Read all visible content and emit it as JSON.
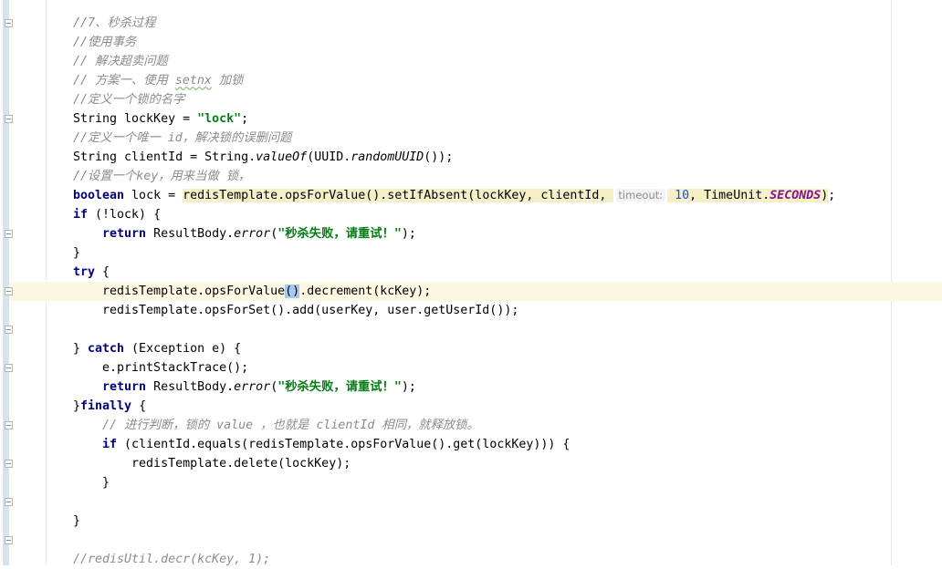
{
  "editor": {
    "lines": [
      {
        "id": "l1",
        "parts": [
          {
            "t": "//7、秒杀过程",
            "c": "cm"
          }
        ]
      },
      {
        "id": "l2",
        "parts": [
          {
            "t": "//使用事务",
            "c": "cm"
          }
        ]
      },
      {
        "id": "l3",
        "parts": [
          {
            "t": "// 解决超卖问题",
            "c": "cm"
          }
        ]
      },
      {
        "id": "l4",
        "parts": [
          {
            "t": "// 方案一、使用 ",
            "c": "cm"
          },
          {
            "t": "setnx",
            "c": "cm warn"
          },
          {
            "t": " 加锁",
            "c": "cm"
          }
        ]
      },
      {
        "id": "l5",
        "parts": [
          {
            "t": "//定义一个锁的名字",
            "c": "cm"
          }
        ]
      },
      {
        "id": "l6",
        "parts": [
          {
            "t": "String lockKey = "
          },
          {
            "t": "\"lock\"",
            "c": "str"
          },
          {
            "t": ";"
          }
        ]
      },
      {
        "id": "l7",
        "parts": [
          {
            "t": "//定义一个唯一 id，解决锁的误删问题",
            "c": "cm"
          }
        ]
      },
      {
        "id": "l8",
        "parts": [
          {
            "t": "String clientId = String."
          },
          {
            "t": "valueOf",
            "c": "it"
          },
          {
            "t": "(UUID."
          },
          {
            "t": "randomUUID",
            "c": "it"
          },
          {
            "t": "());"
          }
        ]
      },
      {
        "id": "l9",
        "parts": [
          {
            "t": "//设置一个key，用来当做 锁，",
            "c": "cm"
          }
        ]
      },
      {
        "id": "l10",
        "parts": [
          {
            "t": "boolean",
            "c": "kw"
          },
          {
            "t": " lock = "
          },
          {
            "t": "redisTemplate.opsForValue().setIfAbsent(lockKey, clientId, ",
            "c": "hl"
          },
          {
            "t": "timeout:",
            "c": "hint"
          },
          {
            "t": " ",
            "c": "hl"
          },
          {
            "t": "10",
            "c": "num hl"
          },
          {
            "t": ", TimeUnit.",
            "c": "hl"
          },
          {
            "t": "SECONDS",
            "c": "const hl"
          },
          {
            "t": ")",
            "c": "hl"
          },
          {
            "t": ";"
          }
        ]
      },
      {
        "id": "l11",
        "parts": [
          {
            "t": "if",
            "c": "kw"
          },
          {
            "t": " (!lock) {"
          }
        ]
      },
      {
        "id": "l12",
        "parts": [
          {
            "t": "    "
          },
          {
            "t": "return",
            "c": "kw"
          },
          {
            "t": " ResultBody."
          },
          {
            "t": "error",
            "c": "it"
          },
          {
            "t": "("
          },
          {
            "t": "\"秒杀失败，请重试！\"",
            "c": "str"
          },
          {
            "t": ");"
          }
        ]
      },
      {
        "id": "l13",
        "parts": [
          {
            "t": "}"
          }
        ]
      },
      {
        "id": "l14",
        "parts": [
          {
            "t": "try",
            "c": "kw"
          },
          {
            "t": " {"
          }
        ]
      },
      {
        "id": "l15",
        "current": true,
        "parts": [
          {
            "t": "    redisTemplate.opsForValue"
          },
          {
            "t": "()",
            "c": "brace-hl"
          },
          {
            "t": ".decrement(kcKey);"
          }
        ]
      },
      {
        "id": "l16",
        "parts": [
          {
            "t": "    redisTemplate.opsForSet().add(userKey, user.getUserId());"
          }
        ]
      },
      {
        "id": "l17",
        "parts": [
          {
            "t": ""
          }
        ]
      },
      {
        "id": "l18",
        "parts": [
          {
            "t": "} "
          },
          {
            "t": "catch",
            "c": "kw"
          },
          {
            "t": " (Exception e) {"
          }
        ]
      },
      {
        "id": "l19",
        "parts": [
          {
            "t": "    e.printStackTrace();"
          }
        ]
      },
      {
        "id": "l20",
        "parts": [
          {
            "t": "    "
          },
          {
            "t": "return",
            "c": "kw"
          },
          {
            "t": " ResultBody."
          },
          {
            "t": "error",
            "c": "it"
          },
          {
            "t": "("
          },
          {
            "t": "\"秒杀失败，请重试！\"",
            "c": "str"
          },
          {
            "t": ");"
          }
        ]
      },
      {
        "id": "l21",
        "parts": [
          {
            "t": "}"
          },
          {
            "t": "finally",
            "c": "kw"
          },
          {
            "t": " {"
          }
        ]
      },
      {
        "id": "l22",
        "parts": [
          {
            "t": "    "
          },
          {
            "t": "// 进行判断，锁的 value ，也就是 clientId 相同，就释放锁。",
            "c": "cm"
          }
        ]
      },
      {
        "id": "l23",
        "parts": [
          {
            "t": "    "
          },
          {
            "t": "if",
            "c": "kw"
          },
          {
            "t": " (clientId.equals(redisTemplate.opsForValue().get(lockKey))) {"
          }
        ]
      },
      {
        "id": "l24",
        "parts": [
          {
            "t": "        redisTemplate.delete(lockKey);"
          }
        ]
      },
      {
        "id": "l25",
        "parts": [
          {
            "t": "    }"
          }
        ]
      },
      {
        "id": "l26",
        "parts": [
          {
            "t": ""
          }
        ]
      },
      {
        "id": "l27",
        "parts": [
          {
            "t": "}"
          }
        ]
      },
      {
        "id": "l28",
        "parts": [
          {
            "t": ""
          }
        ]
      },
      {
        "id": "l29",
        "parts": [
          {
            "t": "//redisUtil.decr(kcKey, 1);",
            "c": "cm"
          }
        ]
      }
    ],
    "fold_markers": [
      0,
      5,
      11,
      14,
      16,
      18,
      21,
      23,
      25,
      27
    ]
  }
}
